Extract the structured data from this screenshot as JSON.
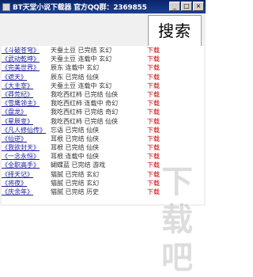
{
  "window": {
    "title": "BT天堂小说下载器 官方QQ群：2369855",
    "buttons": {
      "minimize": "_",
      "maximize": "□",
      "close": "×"
    }
  },
  "search": {
    "label": "搜索"
  },
  "results": [
    {
      "title": "《斗破苍穹》",
      "desc": "天蚕土豆 已完结 玄幻",
      "tag": "下载"
    },
    {
      "title": "《武动乾坤》",
      "desc": "天蚕土豆 连载中 玄幻",
      "tag": "下载"
    },
    {
      "title": "《完美世界》",
      "desc": "辰东 连载中 玄幻",
      "tag": "下载"
    },
    {
      "title": "《遮天》",
      "desc": "辰东 已完结 仙侠",
      "tag": "下载"
    },
    {
      "title": "《大主宰》",
      "desc": "天蚕土豆 连载中 玄幻",
      "tag": "下载"
    },
    {
      "title": "《莽荒纪》",
      "desc": "我吃西红柿 已完结 仙侠",
      "tag": "下载"
    },
    {
      "title": "《雪鹰领主》",
      "desc": "我吃西红柿 连载中 奇幻",
      "tag": "下载"
    },
    {
      "title": "《盘龙》",
      "desc": "我吃西红柿 已完结 奇幻",
      "tag": "下载"
    },
    {
      "title": "《星辰变》",
      "desc": "我吃西红柿 已完结 仙侠",
      "tag": "下载"
    },
    {
      "title": "《凡人修仙传》",
      "desc": "忘语 已完结 仙侠",
      "tag": "下载"
    },
    {
      "title": "《仙逆》",
      "desc": "耳根 已完结 仙侠",
      "tag": "下载"
    },
    {
      "title": "《我欲封天》",
      "desc": "耳根 已完结 仙侠",
      "tag": "下载"
    },
    {
      "title": "《一念永恒》",
      "desc": "耳根 连载中 仙侠",
      "tag": "下载"
    },
    {
      "title": "《全职高手》",
      "desc": "蝴蝶蓝 已完结 游戏",
      "tag": "下载"
    },
    {
      "title": "《择天记》",
      "desc": "猫腻 已完结 玄幻",
      "tag": "下载"
    },
    {
      "title": "《将夜》",
      "desc": "猫腻 已完结 玄幻",
      "tag": "下载"
    },
    {
      "title": "《庆余年》",
      "desc": "猫腻 已完结 历史",
      "tag": "下载"
    }
  ],
  "watermark": "下载吧"
}
